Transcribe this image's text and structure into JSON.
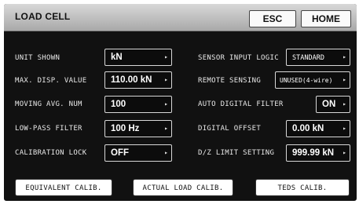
{
  "header": {
    "title": "LOAD CELL",
    "esc_label": "ESC",
    "home_label": "HOME"
  },
  "left_settings": [
    {
      "label": "UNIT SHOWN",
      "value": "kN"
    },
    {
      "label": "MAX. DISP. VALUE",
      "value": "110.00 kN"
    },
    {
      "label": "MOVING AVG. NUM",
      "value": "100"
    },
    {
      "label": "LOW-PASS FILTER",
      "value": "100 Hz"
    },
    {
      "label": "CALIBRATION LOCK",
      "value": "OFF"
    }
  ],
  "right_settings": [
    {
      "label": "SENSOR INPUT LOGIC",
      "value": "STANDARD"
    },
    {
      "label": "REMOTE SENSING",
      "value": "UNUSED(4-wire)"
    },
    {
      "label": "AUTO DIGITAL FILTER",
      "value": "ON"
    },
    {
      "label": "DIGITAL OFFSET",
      "value": "0.00 kN"
    },
    {
      "label": "D/Z LIMIT SETTING",
      "value": "999.99 kN"
    }
  ],
  "footer": {
    "equivalent_calib": "EQUIVALENT CALIB.",
    "actual_load_calib": "ACTUAL LOAD CALIB.",
    "teds_calib": "TEDS CALIB."
  },
  "icons": {
    "dropdown_arrow": "chevron-right-icon"
  }
}
